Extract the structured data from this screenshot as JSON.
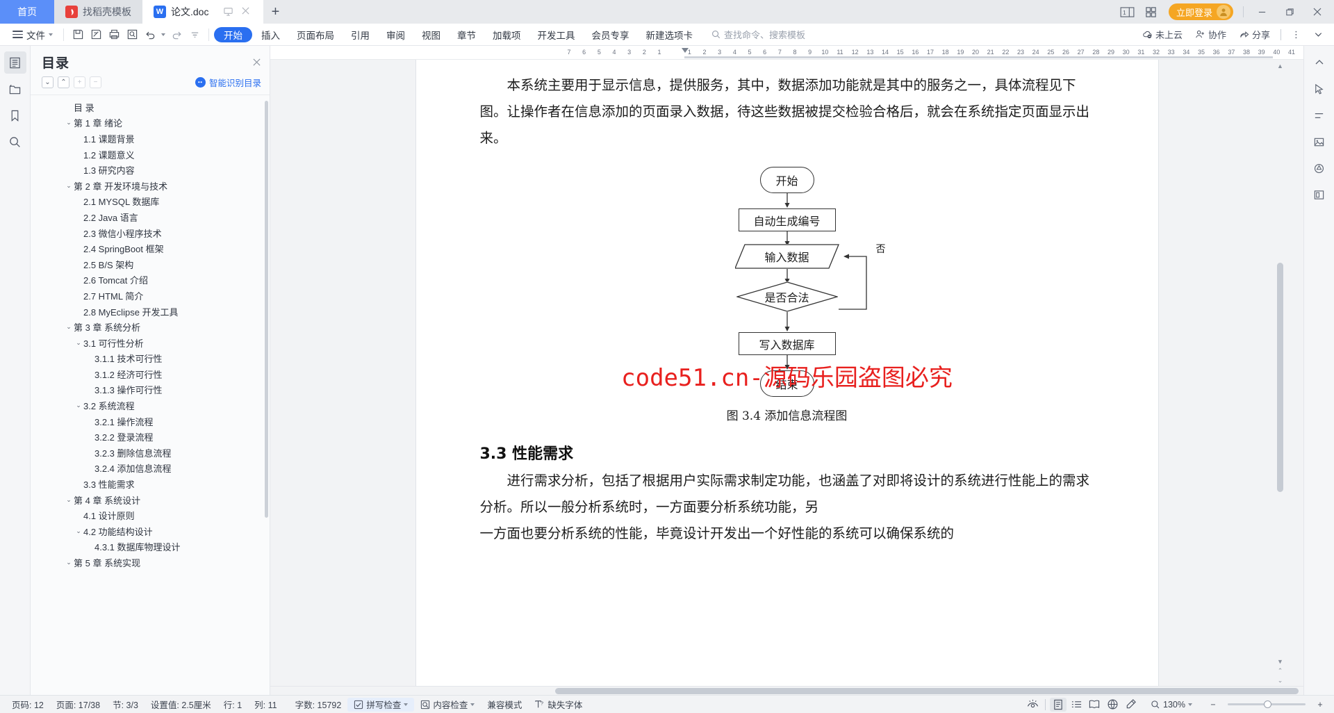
{
  "window": {
    "tabs": [
      {
        "label": "首页",
        "type": "home"
      },
      {
        "label": "找稻壳模板",
        "type": "inactive",
        "icon": "docer-icon"
      },
      {
        "label": "论文.doc",
        "type": "active",
        "icon": "wps-writer-icon"
      }
    ],
    "new_tab_label": "+",
    "view_count": "1",
    "login_label": "立即登录",
    "minimize_label": "—",
    "restore_label": "❐",
    "close_label": "✕"
  },
  "ribbon": {
    "file_label": "文件",
    "quick_icons": [
      "save-icon",
      "save-as-icon",
      "print-icon",
      "print-preview-icon",
      "undo-icon",
      "redo-icon",
      "customize-icon"
    ],
    "tabs": [
      {
        "label": "开始",
        "selected": true
      },
      {
        "label": "插入",
        "selected": false
      },
      {
        "label": "页面布局",
        "selected": false
      },
      {
        "label": "引用",
        "selected": false
      },
      {
        "label": "审阅",
        "selected": false
      },
      {
        "label": "视图",
        "selected": false
      },
      {
        "label": "章节",
        "selected": false
      },
      {
        "label": "加载项",
        "selected": false
      },
      {
        "label": "开发工具",
        "selected": false
      },
      {
        "label": "会员专享",
        "selected": false
      },
      {
        "label": "新建选项卡",
        "selected": false
      }
    ],
    "search_placeholder": "查找命令、搜索模板",
    "right_items": [
      {
        "label": "未上云",
        "icon": "cloud-off-icon"
      },
      {
        "label": "协作",
        "icon": "collaborate-icon"
      },
      {
        "label": "分享",
        "icon": "share-icon"
      }
    ],
    "more_label": "⋮",
    "collapse_label": "⌄"
  },
  "left_rail": [
    {
      "name": "outline-icon",
      "active": true
    },
    {
      "name": "folder-icon",
      "active": false
    },
    {
      "name": "bookmark-icon",
      "active": false
    },
    {
      "name": "search-icon",
      "active": false
    }
  ],
  "right_rail": [
    {
      "name": "caret-up-icon"
    },
    {
      "name": "cursor-icon"
    },
    {
      "name": "format-lines-icon"
    },
    {
      "name": "image-icon"
    },
    {
      "name": "shapes-icon"
    },
    {
      "name": "page-icon"
    }
  ],
  "outline": {
    "title": "目录",
    "close_label": "✕",
    "tools": [
      {
        "name": "expand-all-icon",
        "glyph": "⌄",
        "enabled": true
      },
      {
        "name": "collapse-all-icon",
        "glyph": "⌃",
        "enabled": true
      },
      {
        "name": "increase-level-icon",
        "glyph": "+",
        "enabled": false
      },
      {
        "name": "decrease-level-icon",
        "glyph": "−",
        "enabled": false
      }
    ],
    "smart_label": "智能识别目录",
    "items": [
      {
        "label": "目  录",
        "level": 1,
        "arrow": ""
      },
      {
        "label": "第 1 章  绪论",
        "level": 1,
        "arrow": "⌄"
      },
      {
        "label": "1.1  课题背景",
        "level": 2,
        "arrow": ""
      },
      {
        "label": "1.2  课题意义",
        "level": 2,
        "arrow": ""
      },
      {
        "label": "1.3  研究内容",
        "level": 2,
        "arrow": ""
      },
      {
        "label": "第 2 章  开发环境与技术",
        "level": 1,
        "arrow": "⌄"
      },
      {
        "label": "2.1 MYSQL 数据库",
        "level": 2,
        "arrow": ""
      },
      {
        "label": "2.2 Java 语言",
        "level": 2,
        "arrow": ""
      },
      {
        "label": "2.3  微信小程序技术",
        "level": 2,
        "arrow": ""
      },
      {
        "label": "2.4 SpringBoot 框架",
        "level": 2,
        "arrow": ""
      },
      {
        "label": "2.5 B/S 架构",
        "level": 2,
        "arrow": ""
      },
      {
        "label": "2.6 Tomcat  介绍",
        "level": 2,
        "arrow": ""
      },
      {
        "label": "2.7 HTML 简介",
        "level": 2,
        "arrow": ""
      },
      {
        "label": "2.8 MyEclipse 开发工具",
        "level": 2,
        "arrow": ""
      },
      {
        "label": "第 3 章  系统分析",
        "level": 1,
        "arrow": "⌄"
      },
      {
        "label": "3.1  可行性分析",
        "level": 2,
        "arrow": "⌄"
      },
      {
        "label": "3.1.1  技术可行性",
        "level": 3,
        "arrow": ""
      },
      {
        "label": "3.1.2  经济可行性",
        "level": 3,
        "arrow": ""
      },
      {
        "label": "3.1.3  操作可行性",
        "level": 3,
        "arrow": ""
      },
      {
        "label": "3.2  系统流程",
        "level": 2,
        "arrow": "⌄"
      },
      {
        "label": "3.2.1  操作流程",
        "level": 3,
        "arrow": ""
      },
      {
        "label": "3.2.2  登录流程",
        "level": 3,
        "arrow": ""
      },
      {
        "label": "3.2.3  删除信息流程",
        "level": 3,
        "arrow": ""
      },
      {
        "label": "3.2.4  添加信息流程",
        "level": 3,
        "arrow": ""
      },
      {
        "label": "3.3  性能需求",
        "level": 2,
        "arrow": ""
      },
      {
        "label": "第 4 章  系统设计",
        "level": 1,
        "arrow": "⌄"
      },
      {
        "label": "4.1  设计原则",
        "level": 2,
        "arrow": ""
      },
      {
        "label": "4.2  功能结构设计",
        "level": 2,
        "arrow": "⌄"
      },
      {
        "label": "4.3.1  数据库物理设计",
        "level": 3,
        "arrow": ""
      },
      {
        "label": "第 5 章  系统实现",
        "level": 1,
        "arrow": "⌄"
      }
    ]
  },
  "ruler": {
    "ticks": [
      "7",
      "6",
      "5",
      "4",
      "3",
      "2",
      "1",
      "",
      "1",
      "2",
      "3",
      "4",
      "5",
      "6",
      "7",
      "8",
      "9",
      "10",
      "11",
      "12",
      "13",
      "14",
      "15",
      "16",
      "17",
      "18",
      "19",
      "20",
      "21",
      "22",
      "23",
      "24",
      "25",
      "26",
      "27",
      "28",
      "29",
      "30",
      "31",
      "32",
      "33",
      "34",
      "35",
      "36",
      "37",
      "38",
      "39",
      "40",
      "41"
    ]
  },
  "document": {
    "paragraphs": [
      "本系统主要用于显示信息，提供服务，其中，数据添加功能就是其中的服务之一，具体流程见下图。让操作者在信息添加的页面录入数据，待这些数据被提交检验合格后，就会在系统指定页面显示出来。"
    ],
    "flowchart": {
      "nodes": [
        {
          "label": "开始",
          "shape": "terminator"
        },
        {
          "label": "自动生成编号",
          "shape": "process"
        },
        {
          "label": "输入数据",
          "shape": "parallelogram"
        },
        {
          "label": "是否合法",
          "shape": "decision"
        },
        {
          "label": "写入数据库",
          "shape": "process"
        },
        {
          "label": "结束",
          "shape": "terminator"
        }
      ],
      "edge_labels": [
        "否"
      ]
    },
    "figure_caption": "图 3.4  添加信息流程图",
    "watermark": "code51.cn-源码乐园盗图必究",
    "heading": "3.3  性能需求",
    "after_heading_paragraphs": [
      "进行需求分析，包括了根据用户实际需求制定功能，也涵盖了对即将设计的系统进行性能上的需求分析。所以一般分析系统时，一方面要分析系统功能，另",
      "一方面也要分析系统的性能，毕竟设计开发出一个好性能的系统可以确保系统的"
    ]
  },
  "status_bar": {
    "left_items": [
      {
        "label": "页码: 12",
        "name": "page-number"
      },
      {
        "label": "页面: 17/38",
        "name": "page-of-total"
      },
      {
        "label": "节: 3/3",
        "name": "section"
      },
      {
        "label": "设置值: 2.5厘米",
        "name": "setting-value"
      },
      {
        "label": "行: 1",
        "name": "line-number"
      },
      {
        "label": "列: 11",
        "name": "column-number"
      },
      {
        "label": "字数: 15792",
        "name": "word-count"
      }
    ],
    "spell_check": "拼写检查",
    "content_check": "内容检查",
    "compat_mode": "兼容模式",
    "missing_font": "缺失字体",
    "view_icons": [
      "eye-icon",
      "print-layout-icon",
      "outline-view-icon",
      "reading-layout-icon",
      "web-layout-icon",
      "edit-mode-icon"
    ],
    "zoom_label": "130%",
    "zoom_out": "−",
    "zoom_in": "+"
  },
  "colors": {
    "accent": "#2a6ff0",
    "home_tab": "#5b8ff9",
    "login": "#f5a623",
    "watermark": "#e8201e"
  }
}
